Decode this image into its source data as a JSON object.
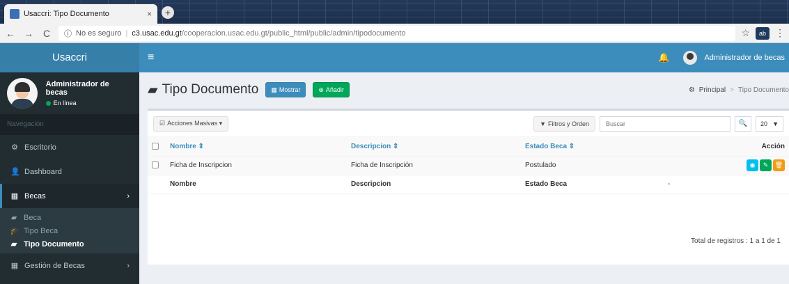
{
  "browser": {
    "tab_title": "Usaccri: Tipo Documento",
    "tab_close": "×",
    "new_tab": "+",
    "back": "←",
    "forward": "→",
    "reload": "C",
    "security_label": "No es seguro",
    "url_host": "c3.usac.edu.gt",
    "url_path": "/cooperacion.usac.edu.gt/public_html/public/admin/tipodocumento",
    "bookmark": "☆",
    "extension": "ab",
    "menu": "⋮"
  },
  "header": {
    "logo": "Usaccri",
    "menu_icon": "≡",
    "bell_icon": "🔔",
    "user_name": "Administrador de becas"
  },
  "sidebar": {
    "user_name": "Administrador de becas",
    "status": "En línea",
    "nav_header": "Navegación",
    "items": [
      {
        "icon": "⚙",
        "label": "Escritorio"
      },
      {
        "icon": "👤",
        "label": "Dashboard"
      },
      {
        "icon": "▦",
        "label": "Becas",
        "chevron": "›"
      },
      {
        "icon": "▦",
        "label": "Gestión de Becas",
        "chevron": "›"
      }
    ],
    "submenu": [
      {
        "icon": "▰",
        "label": "Beca"
      },
      {
        "icon": "🎓",
        "label": "Tipo Beca"
      },
      {
        "icon": "▰",
        "label": "Tipo Documento"
      }
    ]
  },
  "page": {
    "title_icon": "▰",
    "title": "Tipo Documento",
    "show_button": "Mostrar",
    "show_icon": "▦",
    "add_button": "Añadir",
    "add_icon": "⊕",
    "breadcrumb": {
      "home_icon": "⚙",
      "home": "Principal",
      "sep": ">",
      "current": "Tipo Documento"
    }
  },
  "toolbar": {
    "bulk_icon": "☑",
    "bulk_actions": "Acciones Masivas ▾",
    "filters_icon": "▼",
    "filters": "Filtros y Orden",
    "search_placeholder": "Buscar",
    "search_icon": "🔍",
    "page_size": "20",
    "page_size_arrow": "▼"
  },
  "table": {
    "headers": [
      "Nombre ⇕",
      "Descripcion ⇕",
      "Estado Beca ⇕",
      "Acción"
    ],
    "rows": [
      {
        "nombre": "Ficha de Inscripcion",
        "descripcion": "Ficha de Inscripción",
        "estado": "Postulado"
      }
    ],
    "actions": {
      "view": "◉",
      "edit": "✎",
      "delete": "🗑"
    },
    "footer": [
      "Nombre",
      "Descripcion",
      "Estado Beca",
      "-"
    ],
    "totals": "Total de registros : 1 a 1 de 1"
  }
}
